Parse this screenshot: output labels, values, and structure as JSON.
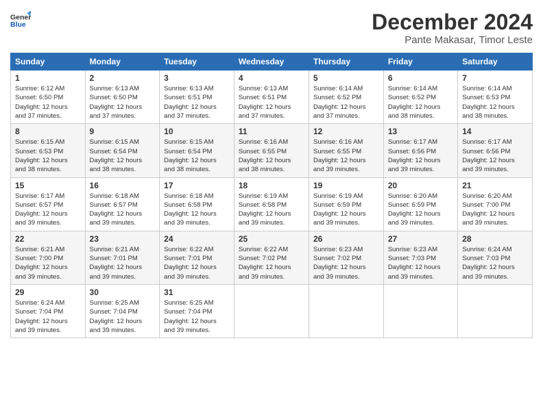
{
  "header": {
    "logo_line1": "General",
    "logo_line2": "Blue",
    "title": "December 2024",
    "subtitle": "Pante Makasar, Timor Leste"
  },
  "calendar": {
    "days_of_week": [
      "Sunday",
      "Monday",
      "Tuesday",
      "Wednesday",
      "Thursday",
      "Friday",
      "Saturday"
    ],
    "weeks": [
      [
        {
          "day": "1",
          "info": "Sunrise: 6:12 AM\nSunset: 6:50 PM\nDaylight: 12 hours\nand 37 minutes."
        },
        {
          "day": "2",
          "info": "Sunrise: 6:13 AM\nSunset: 6:50 PM\nDaylight: 12 hours\nand 37 minutes."
        },
        {
          "day": "3",
          "info": "Sunrise: 6:13 AM\nSunset: 6:51 PM\nDaylight: 12 hours\nand 37 minutes."
        },
        {
          "day": "4",
          "info": "Sunrise: 6:13 AM\nSunset: 6:51 PM\nDaylight: 12 hours\nand 37 minutes."
        },
        {
          "day": "5",
          "info": "Sunrise: 6:14 AM\nSunset: 6:52 PM\nDaylight: 12 hours\nand 37 minutes."
        },
        {
          "day": "6",
          "info": "Sunrise: 6:14 AM\nSunset: 6:52 PM\nDaylight: 12 hours\nand 38 minutes."
        },
        {
          "day": "7",
          "info": "Sunrise: 6:14 AM\nSunset: 6:53 PM\nDaylight: 12 hours\nand 38 minutes."
        }
      ],
      [
        {
          "day": "8",
          "info": "Sunrise: 6:15 AM\nSunset: 6:53 PM\nDaylight: 12 hours\nand 38 minutes."
        },
        {
          "day": "9",
          "info": "Sunrise: 6:15 AM\nSunset: 6:54 PM\nDaylight: 12 hours\nand 38 minutes."
        },
        {
          "day": "10",
          "info": "Sunrise: 6:15 AM\nSunset: 6:54 PM\nDaylight: 12 hours\nand 38 minutes."
        },
        {
          "day": "11",
          "info": "Sunrise: 6:16 AM\nSunset: 6:55 PM\nDaylight: 12 hours\nand 38 minutes."
        },
        {
          "day": "12",
          "info": "Sunrise: 6:16 AM\nSunset: 6:55 PM\nDaylight: 12 hours\nand 39 minutes."
        },
        {
          "day": "13",
          "info": "Sunrise: 6:17 AM\nSunset: 6:56 PM\nDaylight: 12 hours\nand 39 minutes."
        },
        {
          "day": "14",
          "info": "Sunrise: 6:17 AM\nSunset: 6:56 PM\nDaylight: 12 hours\nand 39 minutes."
        }
      ],
      [
        {
          "day": "15",
          "info": "Sunrise: 6:17 AM\nSunset: 6:57 PM\nDaylight: 12 hours\nand 39 minutes."
        },
        {
          "day": "16",
          "info": "Sunrise: 6:18 AM\nSunset: 6:57 PM\nDaylight: 12 hours\nand 39 minutes."
        },
        {
          "day": "17",
          "info": "Sunrise: 6:18 AM\nSunset: 6:58 PM\nDaylight: 12 hours\nand 39 minutes."
        },
        {
          "day": "18",
          "info": "Sunrise: 6:19 AM\nSunset: 6:58 PM\nDaylight: 12 hours\nand 39 minutes."
        },
        {
          "day": "19",
          "info": "Sunrise: 6:19 AM\nSunset: 6:59 PM\nDaylight: 12 hours\nand 39 minutes."
        },
        {
          "day": "20",
          "info": "Sunrise: 6:20 AM\nSunset: 6:59 PM\nDaylight: 12 hours\nand 39 minutes."
        },
        {
          "day": "21",
          "info": "Sunrise: 6:20 AM\nSunset: 7:00 PM\nDaylight: 12 hours\nand 39 minutes."
        }
      ],
      [
        {
          "day": "22",
          "info": "Sunrise: 6:21 AM\nSunset: 7:00 PM\nDaylight: 12 hours\nand 39 minutes."
        },
        {
          "day": "23",
          "info": "Sunrise: 6:21 AM\nSunset: 7:01 PM\nDaylight: 12 hours\nand 39 minutes."
        },
        {
          "day": "24",
          "info": "Sunrise: 6:22 AM\nSunset: 7:01 PM\nDaylight: 12 hours\nand 39 minutes."
        },
        {
          "day": "25",
          "info": "Sunrise: 6:22 AM\nSunset: 7:02 PM\nDaylight: 12 hours\nand 39 minutes."
        },
        {
          "day": "26",
          "info": "Sunrise: 6:23 AM\nSunset: 7:02 PM\nDaylight: 12 hours\nand 39 minutes."
        },
        {
          "day": "27",
          "info": "Sunrise: 6:23 AM\nSunset: 7:03 PM\nDaylight: 12 hours\nand 39 minutes."
        },
        {
          "day": "28",
          "info": "Sunrise: 6:24 AM\nSunset: 7:03 PM\nDaylight: 12 hours\nand 39 minutes."
        }
      ],
      [
        {
          "day": "29",
          "info": "Sunrise: 6:24 AM\nSunset: 7:04 PM\nDaylight: 12 hours\nand 39 minutes."
        },
        {
          "day": "30",
          "info": "Sunrise: 6:25 AM\nSunset: 7:04 PM\nDaylight: 12 hours\nand 39 minutes."
        },
        {
          "day": "31",
          "info": "Sunrise: 6:25 AM\nSunset: 7:04 PM\nDaylight: 12 hours\nand 39 minutes."
        },
        null,
        null,
        null,
        null
      ]
    ]
  }
}
